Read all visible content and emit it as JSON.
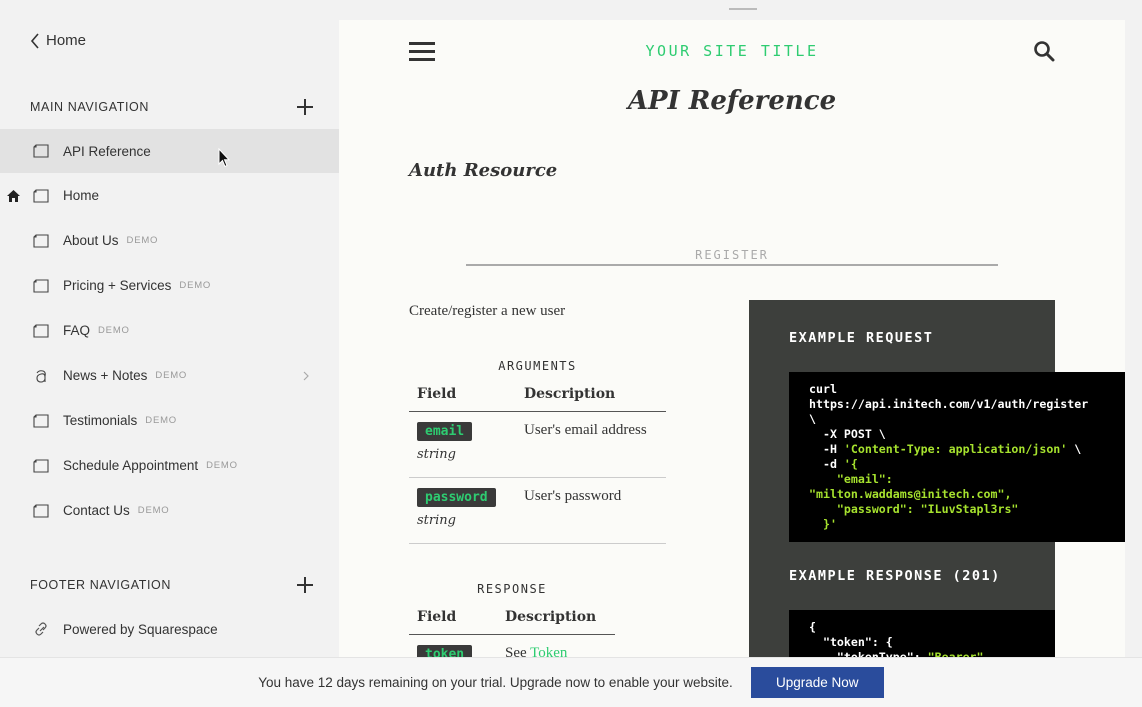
{
  "sidebar": {
    "back_label": "Home",
    "main_nav": {
      "title": "MAIN NAVIGATION",
      "items": [
        {
          "label": "API Reference",
          "demo": ""
        },
        {
          "label": "Home",
          "demo": ""
        },
        {
          "label": "About Us",
          "demo": "DEMO"
        },
        {
          "label": "Pricing + Services",
          "demo": "DEMO"
        },
        {
          "label": "FAQ",
          "demo": "DEMO"
        },
        {
          "label": "News + Notes",
          "demo": "DEMO"
        },
        {
          "label": "Testimonials",
          "demo": "DEMO"
        },
        {
          "label": "Schedule Appointment",
          "demo": "DEMO"
        },
        {
          "label": "Contact Us",
          "demo": "DEMO"
        }
      ]
    },
    "footer_nav": {
      "title": "FOOTER NAVIGATION",
      "items": [
        {
          "label": "Powered by Squarespace"
        }
      ]
    }
  },
  "preview": {
    "site_title": "YOUR SITE TITLE",
    "page_title": "API Reference",
    "section_title": "Auth Resource",
    "divider_label": "REGISTER",
    "description": "Create/register a new user",
    "arguments": {
      "caption": "ARGUMENTS",
      "headers": [
        "Field",
        "Description"
      ],
      "rows": [
        {
          "field": "email",
          "type": "string",
          "description": "User's email address"
        },
        {
          "field": "password",
          "type": "string",
          "description": "User's password"
        }
      ]
    },
    "response": {
      "caption": "RESPONSE",
      "headers": [
        "Field",
        "Description"
      ],
      "rows": [
        {
          "field": "token",
          "description_prefix": "See ",
          "description_link": "Token Object"
        }
      ]
    },
    "code_panel": {
      "request_heading": "EXAMPLE REQUEST",
      "request_lines": [
        {
          "plain": "curl"
        },
        {
          "plain": "https://api.initech.com/v1/auth/register"
        },
        {
          "plain": "\\"
        },
        {
          "plain": "  -X POST \\"
        },
        {
          "plain": "  -H ",
          "str": "'Content-Type: application/json'",
          "tail": " \\"
        },
        {
          "plain": "  -d ",
          "str": "'{"
        },
        {
          "str": "    \"email\":"
        },
        {
          "str": "\"milton.waddams@initech.com\","
        },
        {
          "str": "    \"password\": \"ILuvStapl3rs\""
        },
        {
          "str": "  }'"
        }
      ],
      "response_heading": "EXAMPLE RESPONSE (201)",
      "response_lines": [
        {
          "plain": "{"
        },
        {
          "plain": "  \"token\": {"
        },
        {
          "plain": "    \"tokenType\": ",
          "str": "\"Bearer\","
        }
      ]
    }
  },
  "trial_bar": {
    "message": "You have 12 days remaining on your trial. Upgrade now to enable your website.",
    "button_label": "Upgrade Now"
  },
  "colors": {
    "accent_green": "#2ecc71",
    "upgrade_blue": "#2a4c9c",
    "panel_dark": "#3d3f3c"
  }
}
